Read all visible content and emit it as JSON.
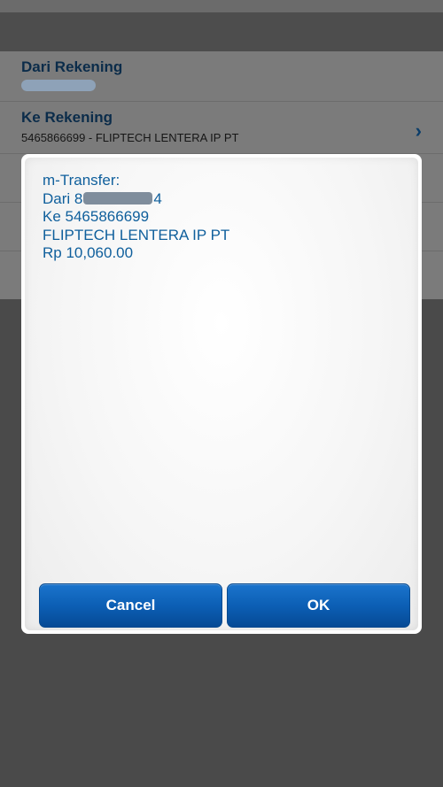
{
  "background": {
    "from_account": {
      "label": "Dari Rekening"
    },
    "to_account": {
      "label": "Ke Rekening",
      "value": "5465866699 - FLIPTECH LENTERA IP PT"
    }
  },
  "dialog": {
    "title_line": "m-Transfer:",
    "from_prefix": "Dari 8",
    "from_suffix": "4",
    "to_line": "Ke 5465866699",
    "name_line": "FLIPTECH LENTERA IP PT",
    "amount_line": "Rp 10,060.00",
    "cancel_label": "Cancel",
    "ok_label": "OK"
  },
  "colors": {
    "accent_blue": "#0c5fb5",
    "message_text": "#0f5f9c",
    "label_text": "#0b2c4a"
  }
}
